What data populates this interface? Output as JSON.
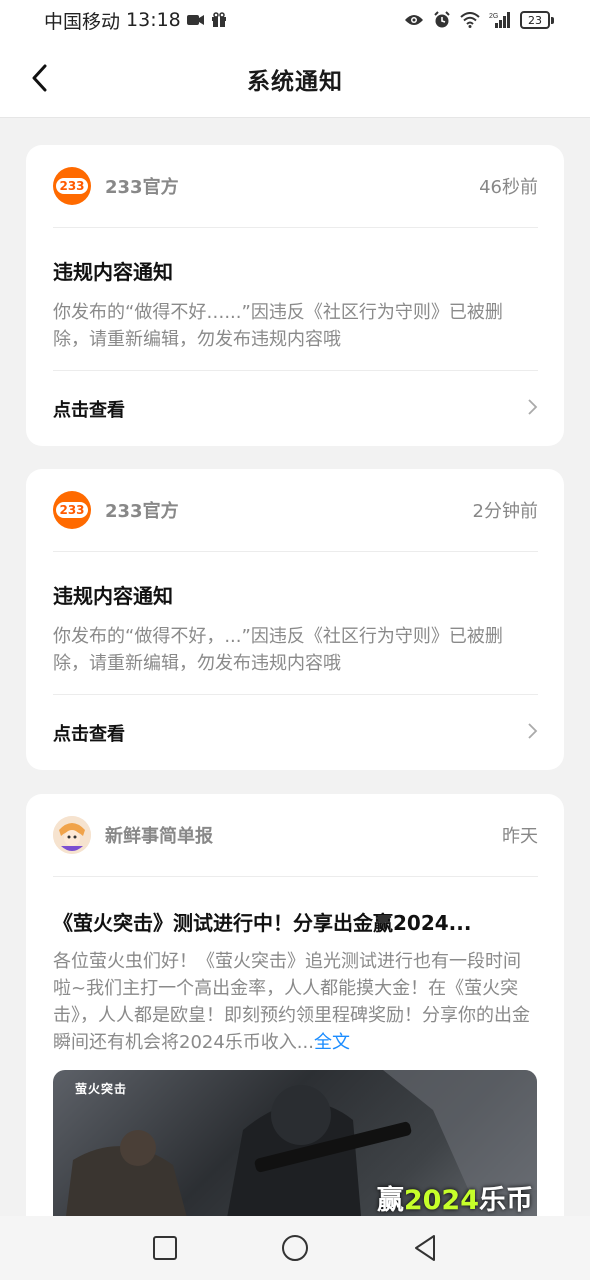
{
  "status_bar": {
    "carrier": "中国移动",
    "time": "13:18",
    "network": "2G",
    "battery": "23",
    "icons": [
      "video-icon",
      "gift-icon",
      "eye-icon",
      "alarm-icon",
      "wifi-icon",
      "signal-icon",
      "battery-icon"
    ]
  },
  "header": {
    "title": "系统通知",
    "back_icon": "back-arrow-icon"
  },
  "notifications": [
    {
      "sender": "233官方",
      "avatar_text": "233",
      "time": "46秒前",
      "title": "违规内容通知",
      "body": "你发布的“做得不好…...”因违反《社区行为守则》已被删除，请重新编辑，勿发布违规内容哦",
      "action": "点击查看"
    },
    {
      "sender": "233官方",
      "avatar_text": "233",
      "time": "2分钟前",
      "title": "违规内容通知",
      "body": "你发布的“做得不好，...”因违反《社区行为守则》已被删除，请重新编辑，勿发布违规内容哦",
      "action": "点击查看"
    },
    {
      "sender": "新鲜事简单报",
      "time": "昨天",
      "title": "《萤火突击》测试进行中！分享出金赢2024...",
      "body": "各位萤火虫们好！《萤火突击》追光测试进行也有一段时间啦~我们主打一个高出金率，人人都能摸大金！在《萤火突击》，人人都是欧皇！即刻预约领里程碑奖励！分享你的出金瞬间还有机会将2024乐币收入...",
      "more_link": "全文",
      "banner": {
        "logo": "萤火突击",
        "prize_prefix": "赢",
        "prize_number": "2024",
        "prize_suffix": "乐币"
      }
    }
  ],
  "nav_bar": {
    "icons": [
      "recent-apps-icon",
      "home-icon",
      "back-icon"
    ]
  },
  "colors": {
    "brand_orange": "#ff6a00",
    "link_blue": "#1a8cff",
    "banner_accent": "#c6ff2a"
  }
}
